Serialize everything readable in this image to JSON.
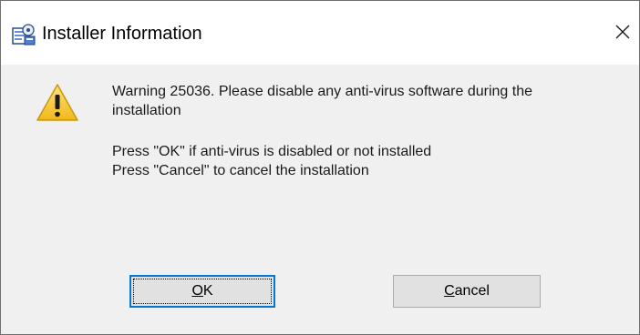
{
  "window": {
    "title": "Installer Information",
    "title_icon": "installer-icon",
    "close_icon": "close-icon"
  },
  "message": {
    "icon": "warning-icon",
    "line1": "Warning 25036. Please disable any anti-virus software during the",
    "line2": "installation",
    "line3": "Press \"OK\" if anti-virus is disabled or not installed",
    "line4": "Press \"Cancel\" to cancel the installation"
  },
  "buttons": {
    "ok": {
      "mnemonic": "O",
      "rest": "K"
    },
    "cancel": {
      "mnemonic": "C",
      "rest": "ancel"
    }
  },
  "colors": {
    "dialog_background": "#f0f0f0",
    "titlebar_background": "#ffffff",
    "default_button_border": "#0078d7",
    "warning_yellow": "#f7c52b"
  }
}
